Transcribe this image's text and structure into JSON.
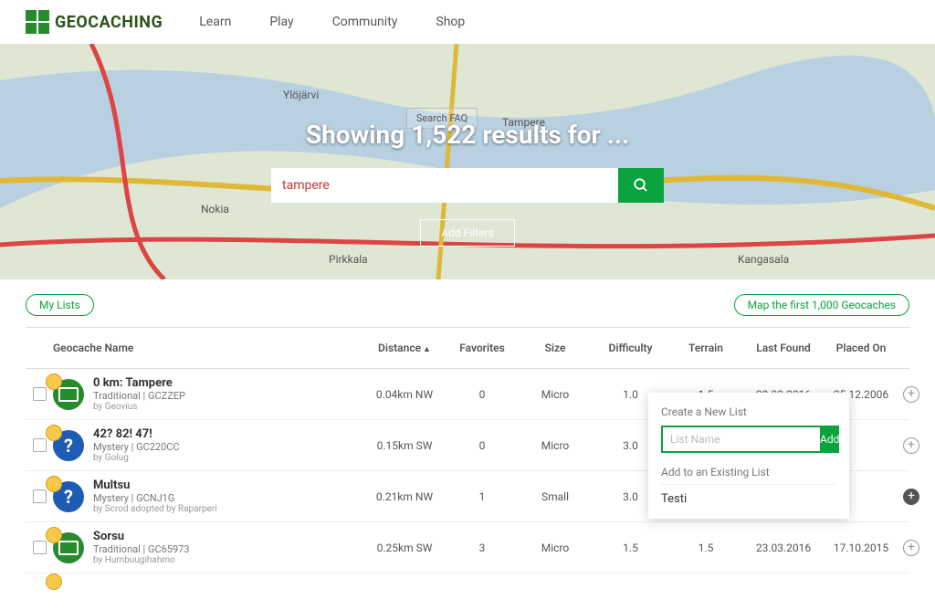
{
  "brand": "GEOCACHING",
  "nav": {
    "learn": "Learn",
    "play": "Play",
    "community": "Community",
    "shop": "Shop"
  },
  "hero": {
    "search_faq": "Search FAQ",
    "title": "Showing 1,522 results for ...",
    "search_value": "tampere",
    "add_filters": "Add Filters"
  },
  "toolbar": {
    "my_lists": "My Lists",
    "map_first": "Map the first 1,000 Geocaches"
  },
  "columns": {
    "name": "Geocache Name",
    "distance": "Distance",
    "favorites": "Favorites",
    "size": "Size",
    "difficulty": "Difficulty",
    "terrain": "Terrain",
    "last_found": "Last Found",
    "placed_on": "Placed On"
  },
  "rows": [
    {
      "title": "0 km: Tampere",
      "type": "Traditional",
      "code": "GCZZEP",
      "by": "by Geovius",
      "distance": "0.04km NW",
      "favorites": "0",
      "size": "Micro",
      "difficulty": "1.0",
      "terrain": "1.5",
      "last_found": "23.03.2016",
      "placed": "25.12.2006",
      "icon": "trad"
    },
    {
      "title": "42? 82! 47!",
      "type": "Mystery",
      "code": "GC220CC",
      "by": "by Golug",
      "distance": "0.15km SW",
      "favorites": "0",
      "size": "Micro",
      "difficulty": "3.0",
      "terrain": "",
      "last_found": "",
      "placed": "",
      "icon": "mystery"
    },
    {
      "title": "Multsu",
      "type": "Mystery",
      "code": "GCNJ1G",
      "by": "by Scrod adopted by Raparperi",
      "distance": "0.21km NW",
      "favorites": "1",
      "size": "Small",
      "difficulty": "3.0",
      "terrain": "",
      "last_found": "",
      "placed": "",
      "icon": "mystery"
    },
    {
      "title": "Sorsu",
      "type": "Traditional",
      "code": "GC65973",
      "by": "by Humbuugihahmo",
      "distance": "0.25km SW",
      "favorites": "3",
      "size": "Micro",
      "difficulty": "1.5",
      "terrain": "1.5",
      "last_found": "23.03.2016",
      "placed": "17.10.2015",
      "icon": "trad"
    }
  ],
  "popover": {
    "create_title": "Create a New List",
    "placeholder": "List Name",
    "add_btn": "Add",
    "existing_title": "Add to an Existing List",
    "existing_item": "Testi"
  }
}
